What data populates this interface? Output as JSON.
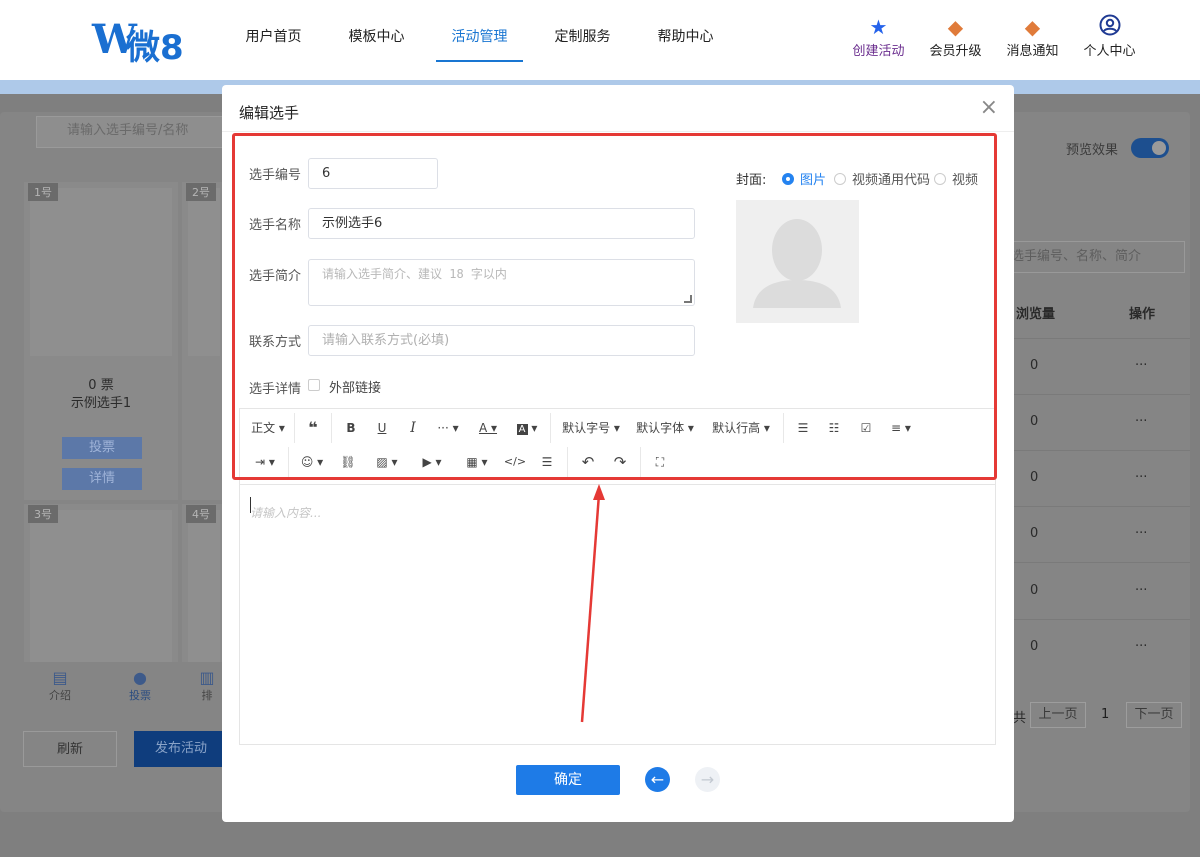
{
  "header": {
    "logo_letter": "W",
    "logo_text": "微8",
    "nav": [
      {
        "label": "用户首页"
      },
      {
        "label": "模板中心"
      },
      {
        "label": "活动管理"
      },
      {
        "label": "定制服务"
      },
      {
        "label": "帮助中心"
      }
    ],
    "user_menu": [
      {
        "label": "创建活动",
        "icon": "star-icon"
      },
      {
        "label": "会员升级",
        "icon": "vip-badge-icon"
      },
      {
        "label": "消息通知",
        "icon": "bell-badge-icon"
      },
      {
        "label": "个人中心",
        "icon": "user-icon"
      }
    ]
  },
  "background": {
    "search_placeholder": "请输入选手编号/名称",
    "cards": [
      {
        "tag": "1号",
        "votes": "0 票",
        "name": "示例选手1",
        "vote_btn": "投票",
        "detail_btn": "详情"
      },
      {
        "tag": "2号"
      },
      {
        "tag": "3号"
      },
      {
        "tag": "4号"
      }
    ],
    "preview_label": "预览效果",
    "right_search_placeholder": "选手编号、名称、简介",
    "col_views": "浏览量",
    "col_action": "操作",
    "rows": [
      {
        "views": "0",
        "action": "···"
      },
      {
        "views": "0",
        "action": "···"
      },
      {
        "views": "0",
        "action": "···"
      },
      {
        "views": "0",
        "action": "···"
      },
      {
        "views": "0",
        "action": "···"
      },
      {
        "views": "0",
        "action": "···"
      }
    ],
    "pagination": {
      "prev": "上一页",
      "page": "1",
      "next": "下一页",
      "total_prefix": "共"
    },
    "bottom_icons": [
      {
        "label": "介绍"
      },
      {
        "label": "投票"
      },
      {
        "label": "排"
      }
    ],
    "refresh_btn": "刷新",
    "publish_btn": "发布活动"
  },
  "modal": {
    "title": "编辑选手",
    "close": "×",
    "fields": {
      "number_label": "选手编号",
      "number_value": "6",
      "name_label": "选手名称",
      "name_value": "示例选手6",
      "intro_label": "选手简介",
      "intro_placeholder": "请输入选手简介、建议 18 字以内",
      "contact_label": "联系方式",
      "contact_placeholder": "请输入联系方式(必填)",
      "detail_label": "选手详情",
      "external_link_label": "外部链接"
    },
    "cover": {
      "label": "封面:",
      "options": [
        {
          "label": "图片",
          "selected": true
        },
        {
          "label": "视频通用代码",
          "selected": false
        },
        {
          "label": "视频",
          "selected": false
        }
      ]
    },
    "toolbar": {
      "row1": [
        "正文",
        "❝",
        "B",
        "U",
        "I",
        "···",
        "A",
        "A",
        "默认字号",
        "默认字体",
        "默认行高",
        "list-icon",
        "ordered-list-icon",
        "checkbox-icon",
        "align-icon"
      ],
      "heading": "正文",
      "font_size": "默认字号",
      "font_family": "默认字体",
      "line_height": "默认行高"
    },
    "editor_placeholder": "请输入内容...",
    "confirm_btn": "确定",
    "prev_icon": "arrow-left-icon",
    "next_icon": "arrow-right-icon"
  },
  "colors": {
    "primary": "#1e7be7",
    "highlight_box": "#e53935",
    "nav_active": "#1976d2"
  }
}
